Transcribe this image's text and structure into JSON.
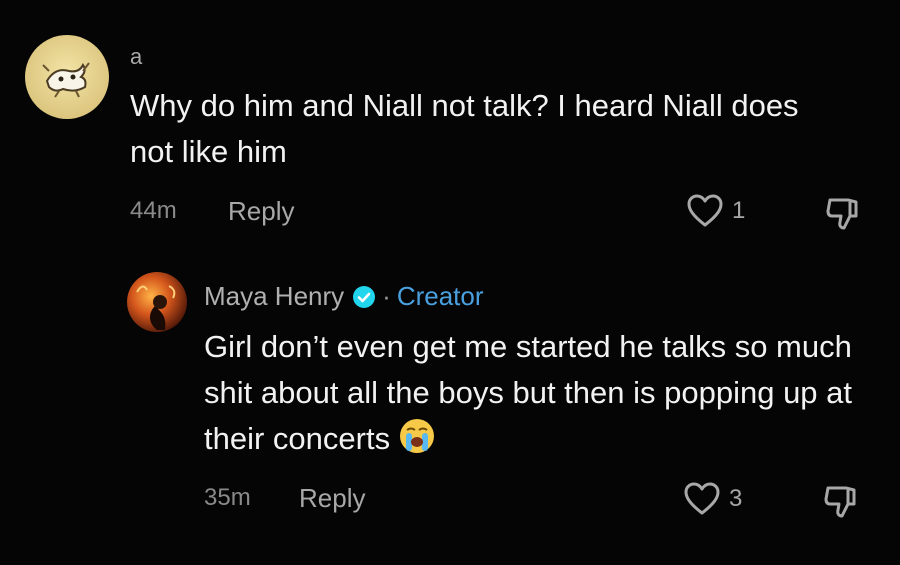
{
  "comments": [
    {
      "username": "a",
      "text": "Why do him and Niall not talk? I heard Niall does not like him",
      "time": "44m",
      "reply_label": "Reply",
      "likes": "1",
      "avatar_icon": "doodle-avatar-icon"
    },
    {
      "username": "Maya Henry",
      "verified": true,
      "separator": "·",
      "role": "Creator",
      "text": "Girl don’t even get me started he talks so much shit about all the boys but then is popping up at their concerts",
      "emoji_icon": "loudly-crying-face-icon",
      "time": "35m",
      "reply_label": "Reply",
      "likes": "3",
      "avatar_icon": "fire-photo-avatar-icon"
    }
  ],
  "colors": {
    "background": "#050505",
    "text": "#f2f2f2",
    "muted": "#8a8a8a",
    "creator_accent": "#4aa0df"
  }
}
